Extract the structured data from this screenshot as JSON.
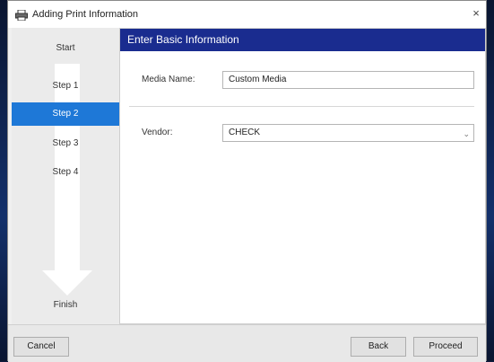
{
  "window": {
    "title": "Adding Print Information",
    "close_glyph": "×"
  },
  "sidebar": {
    "steps": [
      {
        "label": "Start",
        "active": false
      },
      {
        "label": "Step 1",
        "active": false
      },
      {
        "label": "Step 2",
        "active": true
      },
      {
        "label": "Step 3",
        "active": false
      },
      {
        "label": "Step 4",
        "active": false
      },
      {
        "label": "Finish",
        "active": false
      }
    ]
  },
  "main": {
    "header": "Enter Basic Information",
    "media_name_label": "Media Name:",
    "media_name_value": "Custom Media",
    "vendor_label": "Vendor:",
    "vendor_value": "CHECK",
    "vendor_dropdown_glyph": "⌄"
  },
  "footer": {
    "cancel_label": "Cancel",
    "back_label": "Back",
    "proceed_label": "Proceed"
  },
  "colors": {
    "active_step": "#1e78d7",
    "header_bg": "#1a2c8f",
    "background": "#0d1b3c"
  }
}
